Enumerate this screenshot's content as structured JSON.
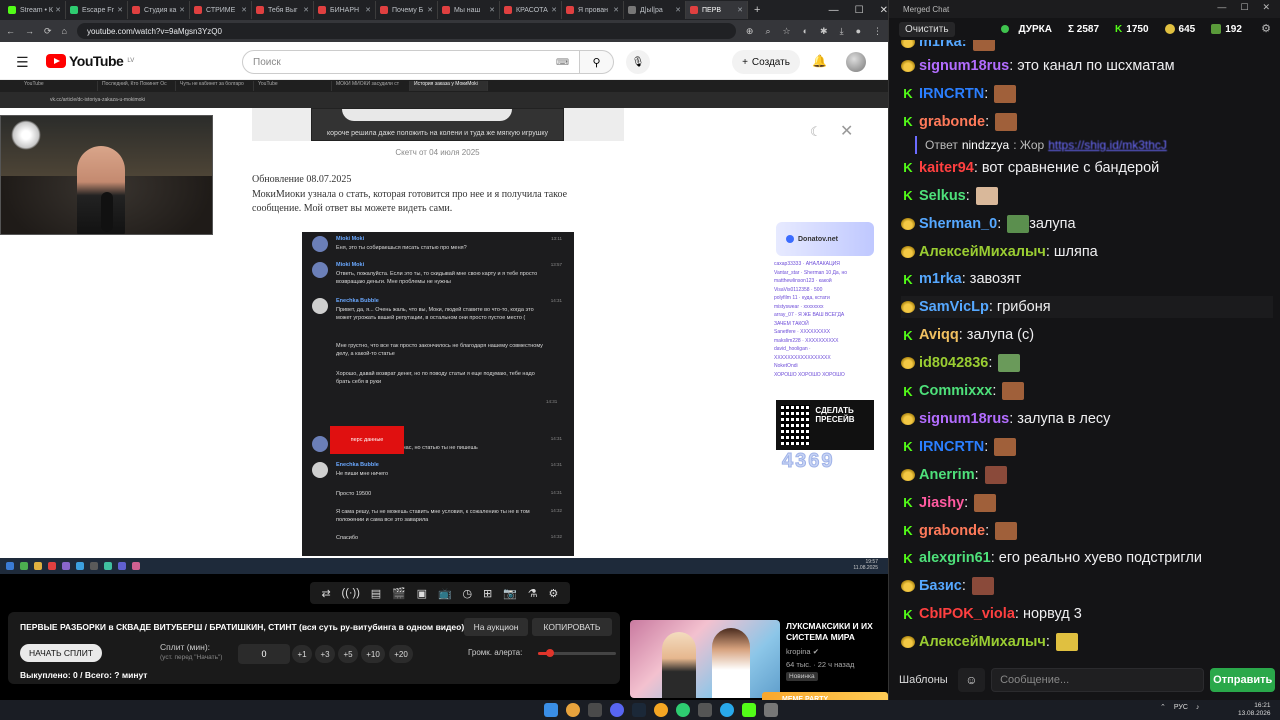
{
  "browser": {
    "tabs": [
      "Stream • К",
      "Escape Fr",
      "Студия ка",
      "СТРИМЕ",
      "Тебя Выг",
      "БИНАРН",
      "Почему Б",
      "Мы наш",
      "КРАСОТА",
      "Я прован",
      "Д|ыl|pa",
      "ПЕРВ"
    ],
    "active_tab": 11,
    "url": "youtube.com/watch?v=9aMgsn3YzQ0"
  },
  "youtube": {
    "logo": "YouTube",
    "logo_region": "LV",
    "search_placeholder": "Поиск",
    "create_label": "Создать"
  },
  "inner": {
    "tabs": [
      "YouTube",
      "Последний, Кто Покинет Ос",
      "Чуть не кабинет за болгаро",
      "YouTube",
      "МОКИ МИОКИ засудили ст",
      "История заказа у МокиMoki"
    ],
    "url": "vk.cc/article/dc-istoriya-zakaza-u-mokimoki",
    "sketch_caption": "короче решила даже положить на колени и туда же мягкую игрушку",
    "sketch_date": "Скетч от 04 июля 2025",
    "update_date": "Обновление 08.07.2025",
    "update_text": "МокиМиоки узнала о стать, которая готовится про нее и я получила такое сообщение. Мой ответ вы можете видеть сами.",
    "chat_messages": [
      {
        "name": "Mioki Moki",
        "text": "Еня, это ты собираешься писать статью про меня?",
        "time": "13:11",
        "color": "#5b7dd6"
      },
      {
        "name": "Mioki Moki",
        "text": "Ответь, пожалуйста. Если это ты, то скидывай мне свою карту и я тебе просто возвращаю деньги. Мне проблемы не нужны",
        "time": "13:57",
        "color": "#5b7dd6"
      },
      {
        "name": "Enechka Bubble",
        "text": "Привет, да, я... Очень жаль, что вы, Моки, людей ставите во что-то, когда это может угрожать вашей репутации, в остальном они просто пустое место (",
        "time": "14:31",
        "color": "#e8e8e8"
      },
      {
        "name": "",
        "text": "Мне грустно, что все так просто закончилось не благодаря нашему совместному делу, а какой-то статье",
        "time": "",
        "color": ""
      },
      {
        "name": "",
        "text": "Хорошо, давай возврат денег, но по поводу статьи я еще подумаю, тебе надо брать себя в руки",
        "time": "",
        "color": ""
      },
      {
        "name": "Mioki Moki",
        "text": "Я верну деньги прямо сейчас, но статью ты не пишешь",
        "time": "14:31",
        "color": "#5b7dd6"
      },
      {
        "name": "Enechka Bubble",
        "text": "Не пиши мне ничего",
        "time": "14:31",
        "color": "#e8e8e8"
      },
      {
        "name": "",
        "text": "Просто 19500",
        "time": "14:31",
        "color": ""
      },
      {
        "name": "",
        "text": "Я сама решу, ты не можешь ставить мне условия, к сожалению ты не в том положении и сама все это заварила",
        "time": "14:32",
        "color": ""
      },
      {
        "name": "",
        "text": "Спасибо",
        "time": "14:32",
        "color": ""
      }
    ],
    "pers_label": "перс данные",
    "pers_time": "14:31",
    "donat_title": "Donatov.net",
    "donat_list": [
      "caxap33333 · АНАЛАКАЦИЯ",
      "Vantar_star · Sherman 10 Да, но",
      "matthewlinson123 · какой",
      "VisaVis0112358 · 500",
      "polyfilm 11 · куда, кстати",
      "mistyswear · хххххххх",
      "array_07 · Я ЖЕ ВАШ ВСЕГДА",
      "ЗАЧЕМ ТАКОЙ",
      "Sanetfere · XXXXXXXXX",
      "makslim228 · XXXXXXXXXX",
      "david_hooligan · ",
      "XXXXXXXXXXXXXXXXX",
      "NoketOndi",
      "ХОРОШО ХОРОШО ХОРОШО"
    ],
    "qr_text": "СДЕЛАТЬ ПРЕСЕЙВ",
    "donat_count": "4369",
    "clock_time": "19:57",
    "clock_date": "11.08.2025"
  },
  "panel": {
    "stream_title": "ПЕРВЫЕ РАЗБОРКИ в СКВАДЕ ВИТУБЕРШ / БРАТИШКИН, СТИНТ (вся суть ру-витубинга в одном видео)",
    "auction_label": "На аукцион",
    "copy_label": "КОПИРОВАТЬ",
    "start_split_label": "НАЧАТЬ СПЛИТ",
    "split_label": "Сплит (мин):",
    "split_hint": "(уст. перед \"Начать\")",
    "split_value": "0",
    "increments": [
      "+1",
      "+3",
      "+5",
      "+10",
      "+20"
    ],
    "volume_label": "Громк. алерта:",
    "volume_level": 0.15,
    "bought": "Выкуплено: 0 / Всего: ? минут"
  },
  "recommended": {
    "title": "ЛУКСМАКСИКИ И ИХ СИСТЕМА МИРА",
    "channel": "kropina",
    "meta": "64 тыс. · 22 ч назад",
    "badge": "Новинка",
    "banner": "MEME PARTY"
  },
  "chat": {
    "window_title": "Merged Chat",
    "clear_label": "Очистить",
    "channel": "ДУРКА",
    "total": "Σ 2587",
    "kick_count": "1750",
    "twitch_count": "645",
    "other_count": "192",
    "messages": [
      {
        "badge": "tw",
        "user": "signum18rus",
        "color": "#b36dff",
        "text": ": это канал по шсхматам",
        "emote": ""
      },
      {
        "badge": "kick",
        "user": "IRNCRTN",
        "color": "#2b7fff",
        "text": ":",
        "emote": "#a0603a"
      },
      {
        "badge": "kick",
        "user": "grabonde",
        "color": "#ff7a5a",
        "text": ":",
        "emote": "#a0603a"
      },
      {
        "badge": "kick",
        "user": "kaiter94",
        "color": "#ff4040",
        "text": ": вот сравнение с бандерой",
        "emote": ""
      },
      {
        "badge": "kick",
        "user": "Selkus",
        "color": "#4ee07a",
        "text": ":",
        "emote": "#d9b89a"
      },
      {
        "badge": "tw",
        "user": "Sherman_0",
        "color": "#56a8ff",
        "text": ":",
        "emote": "#5b8f4e",
        "after": " залупа"
      },
      {
        "badge": "tw",
        "user": "АлексейМихалыч",
        "color": "#9acd32",
        "text": ": шляпа",
        "emote": ""
      },
      {
        "badge": "kick",
        "user": "m1rka",
        "color": "#56a8ff",
        "text": ": завозят",
        "emote": ""
      },
      {
        "badge": "tw",
        "user": "SamVicLp",
        "color": "#56a8ff",
        "text": ": грибоня",
        "emote": ""
      },
      {
        "badge": "kick",
        "user": "Aviqq",
        "color": "#f0c060",
        "text": ": залупа (с)",
        "emote": ""
      },
      {
        "badge": "tw",
        "user": "id8042836",
        "color": "#9acd32",
        "text": ":",
        "emote": "#6a9a5a"
      },
      {
        "badge": "kick",
        "user": "Commixxx",
        "color": "#4ee07a",
        "text": ":",
        "emote": "#a0603a"
      },
      {
        "badge": "tw",
        "user": "signum18rus",
        "color": "#b36dff",
        "text": ": залупа в лесу",
        "emote": ""
      },
      {
        "badge": "kick",
        "user": "IRNCRTN",
        "color": "#2b7fff",
        "text": ":",
        "emote": "#a0603a"
      },
      {
        "badge": "tw",
        "user": "Anerrim",
        "color": "#4ee07a",
        "text": ":",
        "emote": "#8a4a3a"
      },
      {
        "badge": "kick",
        "user": "Jiashy",
        "color": "#ff5aa0",
        "text": ":",
        "emote": "#a0603a"
      },
      {
        "badge": "kick",
        "user": "grabonde",
        "color": "#ff7a5a",
        "text": ":",
        "emote": "#a0603a"
      },
      {
        "badge": "kick",
        "user": "alexgrin61",
        "color": "#4ee07a",
        "text": ": его реально хуево подстригли",
        "emote": ""
      },
      {
        "badge": "tw",
        "user": "Базис",
        "color": "#56a8ff",
        "text": ":",
        "emote": "#8a4a3a"
      },
      {
        "badge": "kick",
        "user": "CbIPOK_viola",
        "color": "#ff4040",
        "text": ": норвуд 3",
        "emote": ""
      },
      {
        "badge": "tw",
        "user": "АлексейМихалыч",
        "color": "#9acd32",
        "text": ":",
        "emote": "#e0c040"
      }
    ],
    "reply": {
      "prefix": "Ответ",
      "name": "nindzzya",
      "text": ": Жор",
      "link": "https://shig.id/mk3thcJ"
    },
    "partial_top": "m1rka:",
    "templates_label": "Шаблоны",
    "input_placeholder": "Сообщение...",
    "send_label": "Отправить"
  },
  "taskbar": {
    "lang": "РУС",
    "time": "16:21",
    "date": "13.08.2026"
  }
}
